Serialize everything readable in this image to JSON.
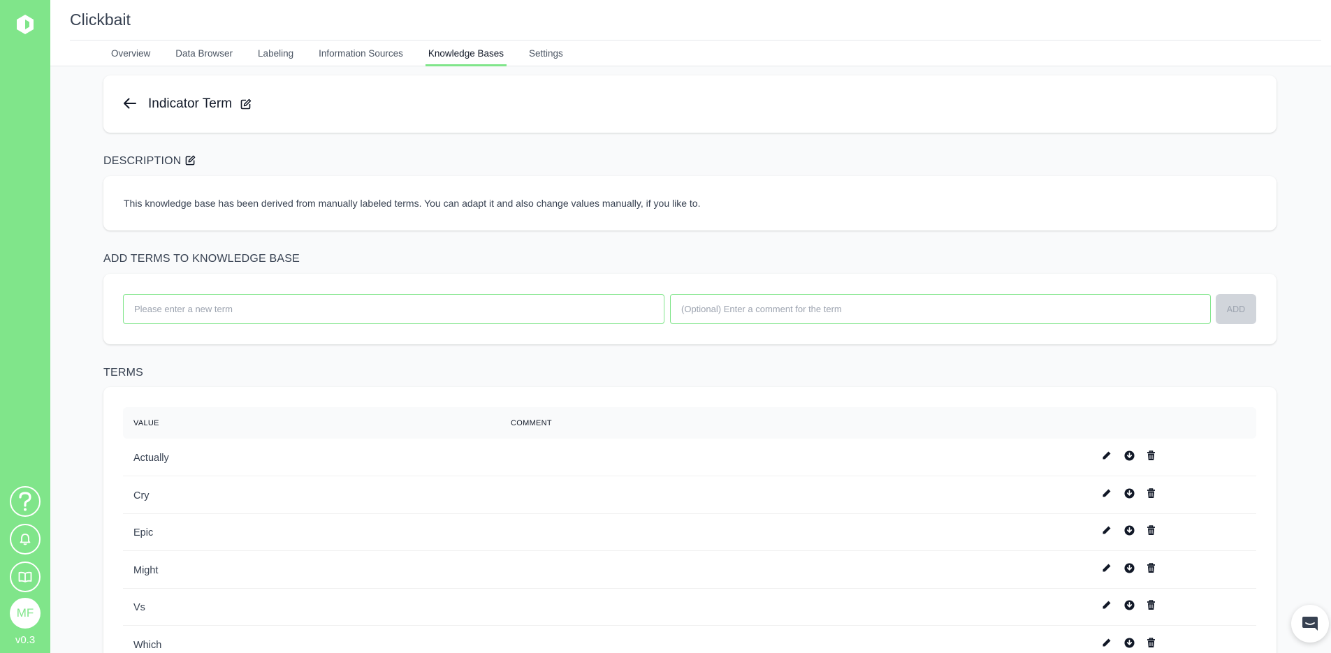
{
  "app": {
    "title": "Clickbait",
    "version": "v0.3"
  },
  "user": {
    "initials": "MF"
  },
  "brand_color": "#80e58a",
  "sidebar": {
    "icons": [
      "app-logo",
      "help-icon",
      "bell-icon",
      "book-icon"
    ]
  },
  "tabs": [
    {
      "label": "Overview",
      "active": false
    },
    {
      "label": "Data Browser",
      "active": false
    },
    {
      "label": "Labeling",
      "active": false
    },
    {
      "label": "Information Sources",
      "active": false
    },
    {
      "label": "Knowledge Bases",
      "active": true
    },
    {
      "label": "Settings",
      "active": false
    }
  ],
  "page": {
    "title": "Indicator Term"
  },
  "description": {
    "heading": "DESCRIPTION",
    "text": "This knowledge base has been derived from manually labeled terms. You can adapt it and also change values manually, if you like to."
  },
  "add_terms": {
    "heading": "ADD TERMS TO KNOWLEDGE BASE",
    "term_placeholder": "Please enter a new term",
    "comment_placeholder": "(Optional) Enter a comment for the term",
    "add_label": "ADD"
  },
  "terms": {
    "heading": "TERMS",
    "columns": [
      "VALUE",
      "COMMENT"
    ],
    "rows": [
      {
        "value": "Actually",
        "comment": ""
      },
      {
        "value": "Cry",
        "comment": ""
      },
      {
        "value": "Epic",
        "comment": ""
      },
      {
        "value": "Might",
        "comment": ""
      },
      {
        "value": "Vs",
        "comment": ""
      },
      {
        "value": "Which",
        "comment": ""
      }
    ],
    "row_actions": [
      "pencil-icon",
      "download-icon",
      "trash-icon"
    ]
  }
}
